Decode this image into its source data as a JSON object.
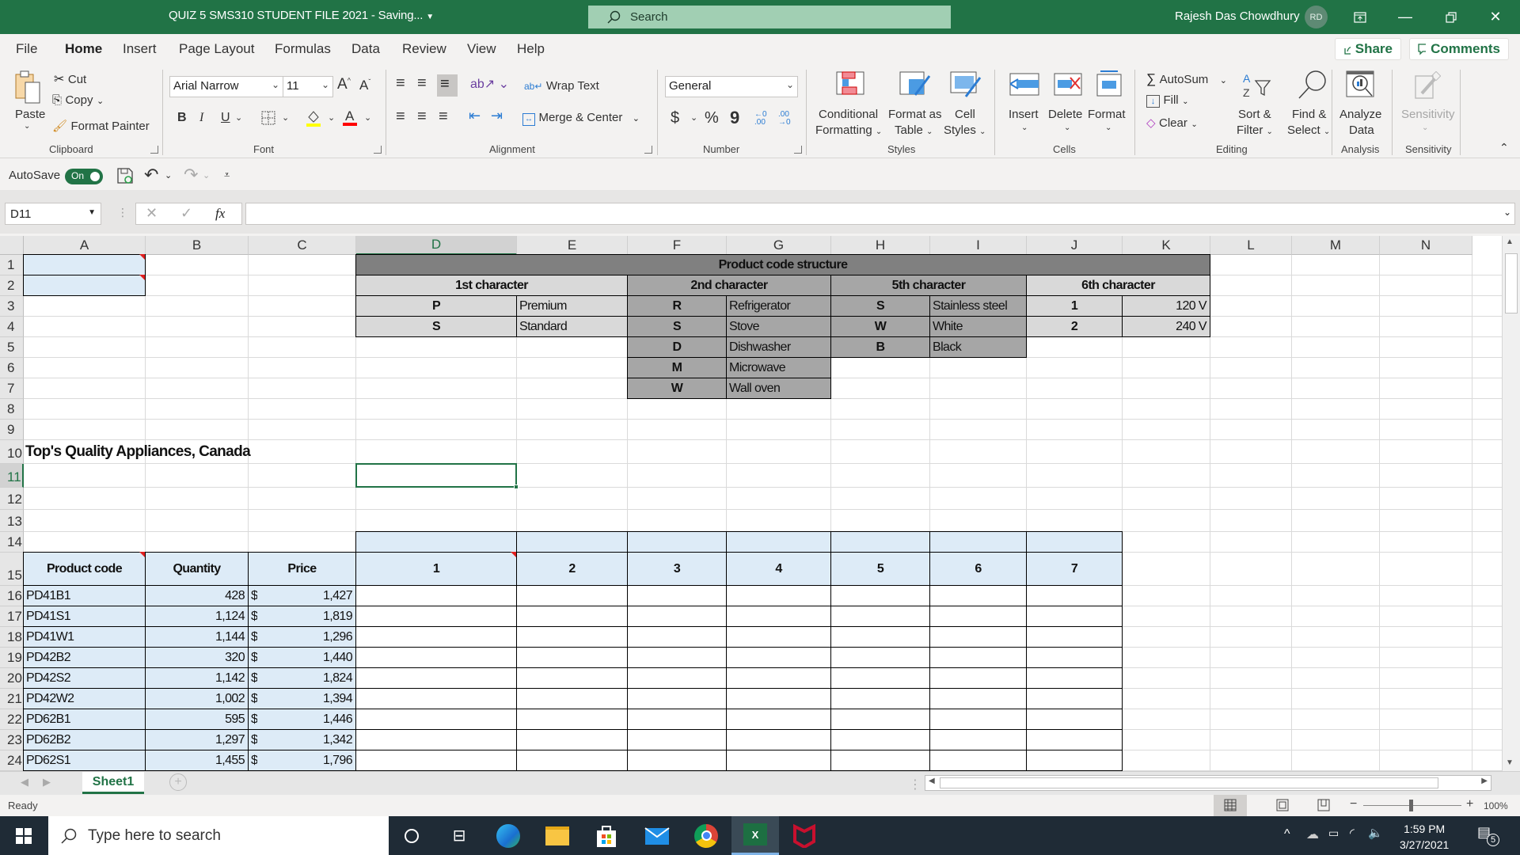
{
  "window": {
    "title": "QUIZ 5 SMS310 STUDENT FILE 2021  -  Saving...",
    "search_placeholder": "Search",
    "user_name": "Rajesh Das Chowdhury",
    "user_initials": "RD"
  },
  "menu": {
    "tabs": [
      "File",
      "Home",
      "Insert",
      "Page Layout",
      "Formulas",
      "Data",
      "Review",
      "View",
      "Help"
    ],
    "active": "Home",
    "share": "Share",
    "comments": "Comments"
  },
  "ribbon": {
    "clipboard": {
      "paste": "Paste",
      "cut": "Cut",
      "copy": "Copy",
      "format_painter": "Format Painter",
      "label": "Clipboard"
    },
    "font": {
      "name": "Arial Narrow",
      "size": "11",
      "label": "Font",
      "bold": "B",
      "italic": "I",
      "underline": "U"
    },
    "alignment": {
      "wrap_text": "Wrap Text",
      "merge_center": "Merge & Center",
      "label": "Alignment"
    },
    "number": {
      "format": "General",
      "currency": "$",
      "percent": "%",
      "comma": "9",
      "label": "Number"
    },
    "styles": {
      "conditional": "Conditional",
      "conditional2": "Formatting",
      "format_table": "Format as",
      "format_table2": "Table",
      "cell_styles": "Cell",
      "cell_styles2": "Styles",
      "label": "Styles"
    },
    "cells": {
      "insert": "Insert",
      "delete": "Delete",
      "format": "Format",
      "label": "Cells"
    },
    "editing": {
      "autosum": "AutoSum",
      "fill": "Fill",
      "clear": "Clear",
      "sort": "Sort &",
      "sort2": "Filter",
      "find": "Find &",
      "find2": "Select",
      "label": "Editing"
    },
    "analysis": {
      "analyze": "Analyze",
      "analyze2": "Data",
      "label": "Analysis"
    },
    "sensitivity": {
      "button": "Sensitivity",
      "label": "Sensitivity"
    }
  },
  "qat": {
    "autosave_label": "AutoSave",
    "autosave_state": "On"
  },
  "formula_bar": {
    "name_box": "D11",
    "fx": "fx",
    "formula": ""
  },
  "columns": [
    "A",
    "B",
    "C",
    "D",
    "E",
    "F",
    "G",
    "H",
    "I",
    "J",
    "K",
    "L",
    "M",
    "N"
  ],
  "selected_column": "D",
  "rows": [
    "1",
    "2",
    "3",
    "4",
    "5",
    "6",
    "7",
    "8",
    "9",
    "10",
    "11",
    "12",
    "13",
    "14",
    "15",
    "16",
    "17",
    "18",
    "19",
    "20",
    "21",
    "22",
    "23",
    "24"
  ],
  "selected_row": "11",
  "code_structure": {
    "title": "Product code structure",
    "first": {
      "header": "1st character",
      "items": [
        {
          "code": "P",
          "meaning": "Premium"
        },
        {
          "code": "S",
          "meaning": "Standard"
        }
      ]
    },
    "second": {
      "header": "2nd character",
      "items": [
        {
          "code": "R",
          "meaning": "Refrigerator"
        },
        {
          "code": "S",
          "meaning": "Stove"
        },
        {
          "code": "D",
          "meaning": "Dishwasher"
        },
        {
          "code": "M",
          "meaning": "Microwave"
        },
        {
          "code": "W",
          "meaning": "Wall oven"
        }
      ]
    },
    "fifth": {
      "header": "5th character",
      "items": [
        {
          "code": "S",
          "meaning": "Stainless steel"
        },
        {
          "code": "W",
          "meaning": "White"
        },
        {
          "code": "B",
          "meaning": "Black"
        }
      ]
    },
    "sixth": {
      "header": "6th character",
      "items": [
        {
          "code": "1",
          "meaning": "120 V"
        },
        {
          "code": "2",
          "meaning": "240 V"
        }
      ]
    }
  },
  "company_title": "Top's Quality Appliances, Canada",
  "table": {
    "headers": [
      "Product code",
      "Quantity",
      "Price",
      "1",
      "2",
      "3",
      "4",
      "5",
      "6",
      "7"
    ],
    "currency_symbol": "$",
    "rows": [
      {
        "code": "PD41B1",
        "qty": "428",
        "price": "1,427"
      },
      {
        "code": "PD41S1",
        "qty": "1,124",
        "price": "1,819"
      },
      {
        "code": "PD41W1",
        "qty": "1,144",
        "price": "1,296"
      },
      {
        "code": "PD42B2",
        "qty": "320",
        "price": "1,440"
      },
      {
        "code": "PD42S2",
        "qty": "1,142",
        "price": "1,824"
      },
      {
        "code": "PD42W2",
        "qty": "1,002",
        "price": "1,394"
      },
      {
        "code": "PD62B1",
        "qty": "595",
        "price": "1,446"
      },
      {
        "code": "PD62B2",
        "qty": "1,297",
        "price": "1,342"
      },
      {
        "code": "PD62S1",
        "qty": "1,455",
        "price": "1,796"
      }
    ]
  },
  "sheets": {
    "tabs": [
      "Sheet1"
    ],
    "active": "Sheet1"
  },
  "status": {
    "text": "Ready",
    "zoom": "100%"
  },
  "taskbar": {
    "search_placeholder": "Type here to search",
    "time": "1:59 PM",
    "date": "3/27/2021",
    "notifications": "5"
  },
  "colors": {
    "excel_green": "#217346",
    "header_fill": "#ddebf7",
    "dark_gray": "#808080",
    "mid_gray": "#a6a6a6",
    "light_gray": "#d9d9d9"
  }
}
